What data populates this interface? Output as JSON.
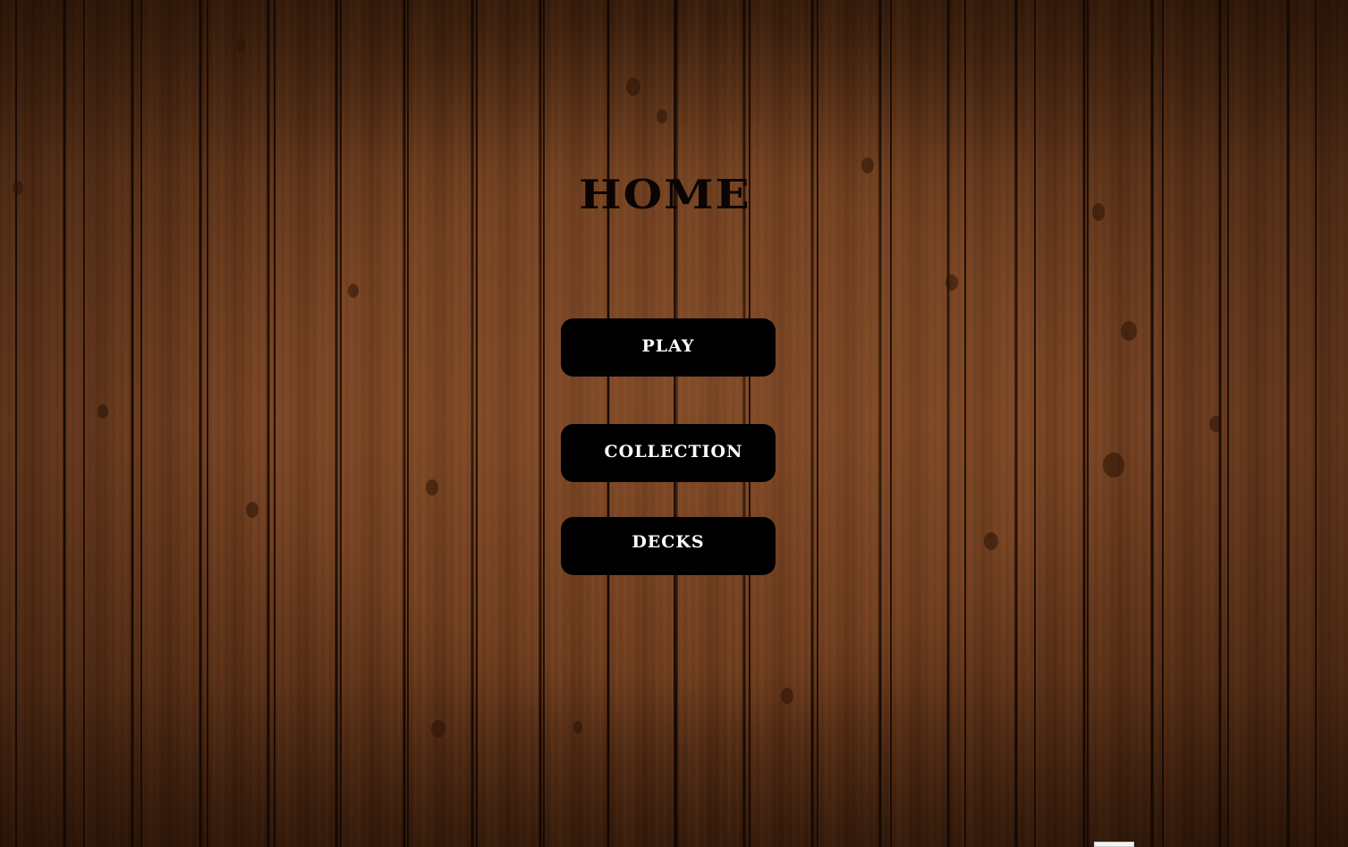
{
  "page": {
    "title": "HOME"
  },
  "menu": {
    "play_label": "PLAY",
    "collection_label": "COLLECTION",
    "decks_label": "DECKS"
  },
  "colors": {
    "background_wood": "#6b3a1c",
    "button_bg": "#000000",
    "button_text": "#ffffff",
    "title_text": "#0a0503"
  }
}
